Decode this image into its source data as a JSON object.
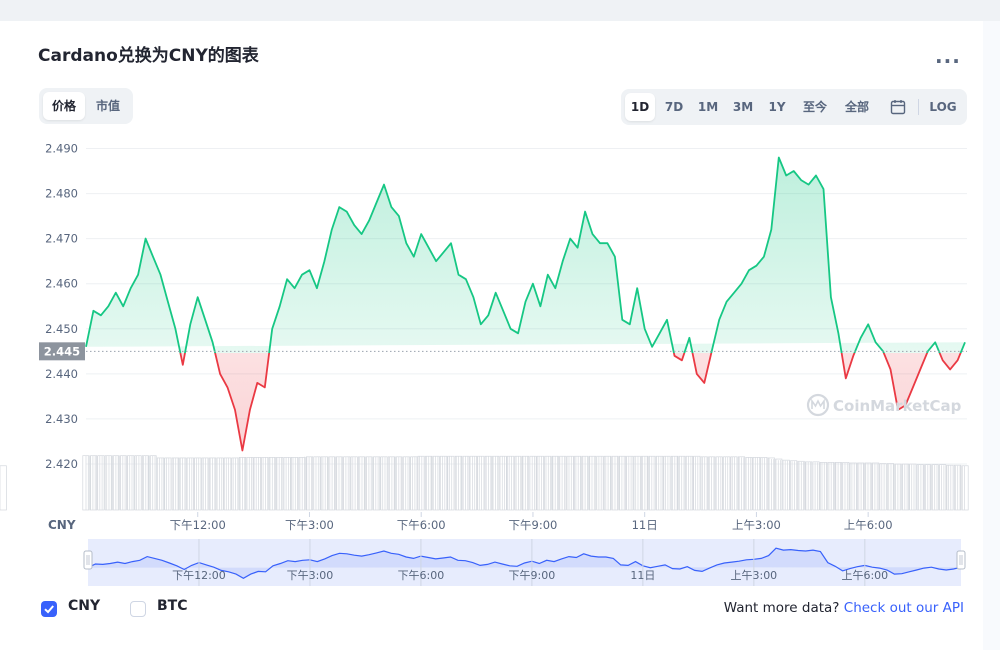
{
  "header": {
    "title": "Cardano兑换为CNY的图表",
    "more_label": "..."
  },
  "tabs_left": [
    {
      "label": "价格",
      "active": true
    },
    {
      "label": "市值",
      "active": false
    }
  ],
  "tabs_right": [
    {
      "label": "1D",
      "active": true
    },
    {
      "label": "7D",
      "active": false
    },
    {
      "label": "1M",
      "active": false
    },
    {
      "label": "3M",
      "active": false
    },
    {
      "label": "1Y",
      "active": false
    },
    {
      "label": "至今",
      "active": false
    },
    {
      "label": "全部",
      "active": false
    },
    {
      "label": "calendar-icon",
      "active": false
    },
    {
      "label": "LOG",
      "active": false
    }
  ],
  "legend": {
    "cny_label": "CNY",
    "btc_label": "BTC",
    "cny_checked": true,
    "btc_checked": false
  },
  "footer": {
    "prompt": "Want more data?",
    "link": "Check out our API"
  },
  "watermark": "CoinMarketCap",
  "colors": {
    "up": "#16c784",
    "down": "#ea3943",
    "accent": "#3861fb",
    "volume": "#d9dde3",
    "navigator": "#3861fb"
  },
  "chart_data": {
    "type": "line",
    "currency_label": "CNY",
    "ylim": [
      2.42,
      2.49
    ],
    "yticks": [
      "2.490",
      "2.480",
      "2.470",
      "2.460",
      "2.450",
      "2.440",
      "2.430",
      "2.420"
    ],
    "reference_value": 2.445,
    "reference_label": "2.445",
    "xticks": [
      "下午12:00",
      "下午3:00",
      "下午6:00",
      "下午9:00",
      "11日",
      "上午3:00",
      "上午6:00"
    ],
    "xtick_hours": [
      3,
      6,
      9,
      12,
      15,
      18,
      21
    ],
    "x_hours": [
      0.0,
      0.2,
      0.4,
      0.6,
      0.8,
      1.0,
      1.2,
      1.4,
      1.6,
      1.8,
      2.0,
      2.2,
      2.4,
      2.6,
      2.8,
      3.0,
      3.2,
      3.4,
      3.6,
      3.8,
      4.0,
      4.2,
      4.4,
      4.6,
      4.8,
      5.0,
      5.2,
      5.4,
      5.6,
      5.8,
      6.0,
      6.2,
      6.4,
      6.6,
      6.8,
      7.0,
      7.2,
      7.4,
      7.6,
      7.8,
      8.0,
      8.2,
      8.4,
      8.6,
      8.8,
      9.0,
      9.2,
      9.4,
      9.6,
      9.8,
      10.0,
      10.2,
      10.4,
      10.6,
      10.8,
      11.0,
      11.2,
      11.4,
      11.6,
      11.8,
      12.0,
      12.2,
      12.4,
      12.6,
      12.8,
      13.0,
      13.2,
      13.4,
      13.6,
      13.8,
      14.0,
      14.2,
      14.4,
      14.6,
      14.8,
      15.0,
      15.2,
      15.4,
      15.6,
      15.8,
      16.0,
      16.2,
      16.4,
      16.6,
      16.8,
      17.0,
      17.2,
      17.4,
      17.6,
      17.8,
      18.0,
      18.2,
      18.4,
      18.6,
      18.8,
      19.0,
      19.2,
      19.4,
      19.6,
      19.8,
      20.0,
      20.2,
      20.4,
      20.6,
      20.8,
      21.0,
      21.2,
      21.4,
      21.6,
      21.8,
      22.0,
      22.2,
      22.4,
      22.6,
      22.8,
      23.0,
      23.2,
      23.4,
      23.6
    ],
    "values": [
      2.446,
      2.454,
      2.453,
      2.455,
      2.458,
      2.455,
      2.459,
      2.462,
      2.47,
      2.466,
      2.462,
      2.456,
      2.45,
      2.442,
      2.451,
      2.457,
      2.452,
      2.447,
      2.44,
      2.437,
      2.432,
      2.423,
      2.432,
      2.438,
      2.437,
      2.45,
      2.455,
      2.461,
      2.459,
      2.462,
      2.463,
      2.459,
      2.465,
      2.472,
      2.477,
      2.476,
      2.473,
      2.471,
      2.474,
      2.478,
      2.482,
      2.477,
      2.475,
      2.469,
      2.466,
      2.471,
      2.468,
      2.465,
      2.467,
      2.469,
      2.462,
      2.461,
      2.457,
      2.451,
      2.453,
      2.458,
      2.454,
      2.45,
      2.449,
      2.456,
      2.46,
      2.455,
      2.462,
      2.459,
      2.465,
      2.47,
      2.468,
      2.476,
      2.471,
      2.469,
      2.469,
      2.466,
      2.452,
      2.451,
      2.459,
      2.45,
      2.446,
      2.449,
      2.452,
      2.444,
      2.443,
      2.448,
      2.44,
      2.438,
      2.445,
      2.452,
      2.456,
      2.458,
      2.46,
      2.463,
      2.464,
      2.466,
      2.472,
      2.488,
      2.484,
      2.485,
      2.483,
      2.482,
      2.484,
      2.481,
      2.457,
      2.449,
      2.439,
      2.444,
      2.448,
      2.451,
      2.447,
      2.445,
      2.441,
      2.432,
      2.433,
      2.437,
      2.441,
      2.445,
      2.447,
      2.443,
      2.441,
      2.443,
      2.447,
      2.451
    ],
    "volume_relative": [
      0.97,
      0.97,
      0.97,
      0.97,
      0.97,
      0.97,
      0.97,
      0.97,
      0.97,
      0.97,
      0.93,
      0.93,
      0.93,
      0.93,
      0.93,
      0.93,
      0.93,
      0.93,
      0.93,
      0.93,
      0.93,
      0.94,
      0.94,
      0.94,
      0.94,
      0.94,
      0.94,
      0.94,
      0.94,
      0.94,
      0.95,
      0.95,
      0.95,
      0.95,
      0.95,
      0.95,
      0.95,
      0.95,
      0.95,
      0.95,
      0.95,
      0.95,
      0.95,
      0.95,
      0.95,
      0.96,
      0.96,
      0.96,
      0.96,
      0.96,
      0.96,
      0.96,
      0.96,
      0.96,
      0.96,
      0.96,
      0.96,
      0.96,
      0.96,
      0.96,
      0.96,
      0.96,
      0.96,
      0.96,
      0.96,
      0.96,
      0.96,
      0.96,
      0.96,
      0.96,
      0.96,
      0.96,
      0.96,
      0.96,
      0.96,
      0.96,
      0.96,
      0.96,
      0.96,
      0.96,
      0.96,
      0.96,
      0.96,
      0.95,
      0.95,
      0.95,
      0.95,
      0.95,
      0.95,
      0.94,
      0.94,
      0.94,
      0.93,
      0.91,
      0.89,
      0.88,
      0.87,
      0.86,
      0.86,
      0.85,
      0.85,
      0.85,
      0.85,
      0.84,
      0.84,
      0.84,
      0.84,
      0.83,
      0.83,
      0.82,
      0.82,
      0.82,
      0.81,
      0.81,
      0.81,
      0.81,
      0.8,
      0.8,
      0.79,
      0.79
    ],
    "grid": true,
    "legend": [
      "CNY",
      "BTC"
    ]
  }
}
